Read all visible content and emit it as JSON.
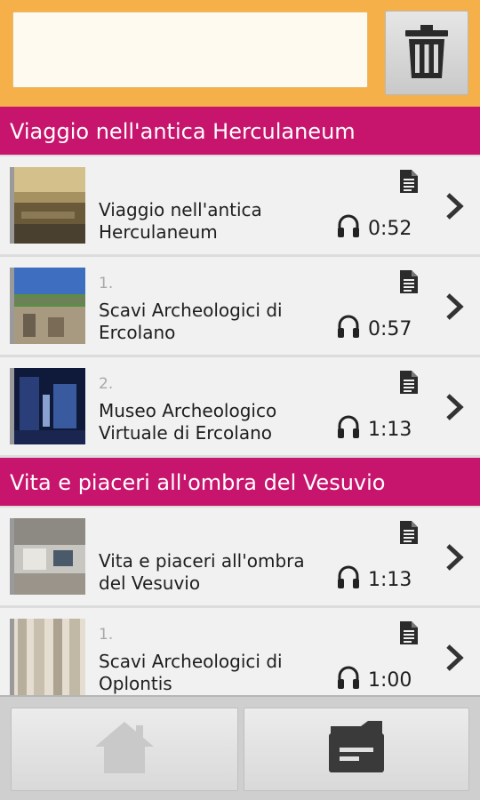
{
  "search": {
    "value": "",
    "placeholder": ""
  },
  "icons": {
    "trash": "trash-icon",
    "doc": "document-icon",
    "headphones": "headphones-icon",
    "chevron": "chevron-right-icon",
    "home": "home-icon",
    "tour": "tour-folder-icon"
  },
  "colors": {
    "topbar": "#f6b04a",
    "section": "#c7146d",
    "item_bg": "#f1f1f1"
  },
  "sections": [
    {
      "title": "Viaggio nell'antica Herculaneum",
      "items": [
        {
          "num": "",
          "title": "Viaggio nell'antica Herculaneum",
          "duration": "0:52"
        },
        {
          "num": "1.",
          "title": "Scavi Archeologici di Ercolano",
          "duration": "0:57"
        },
        {
          "num": "2.",
          "title": "Museo Archeologico Virtuale di Ercolano",
          "duration": "1:13"
        }
      ]
    },
    {
      "title": "Vita e piaceri all'ombra del Vesuvio",
      "items": [
        {
          "num": "",
          "title": "Vita e piaceri all'ombra del Vesuvio",
          "duration": "1:13"
        },
        {
          "num": "1.",
          "title": "Scavi Archeologici di Oplontis",
          "duration": "1:00"
        }
      ]
    }
  ]
}
